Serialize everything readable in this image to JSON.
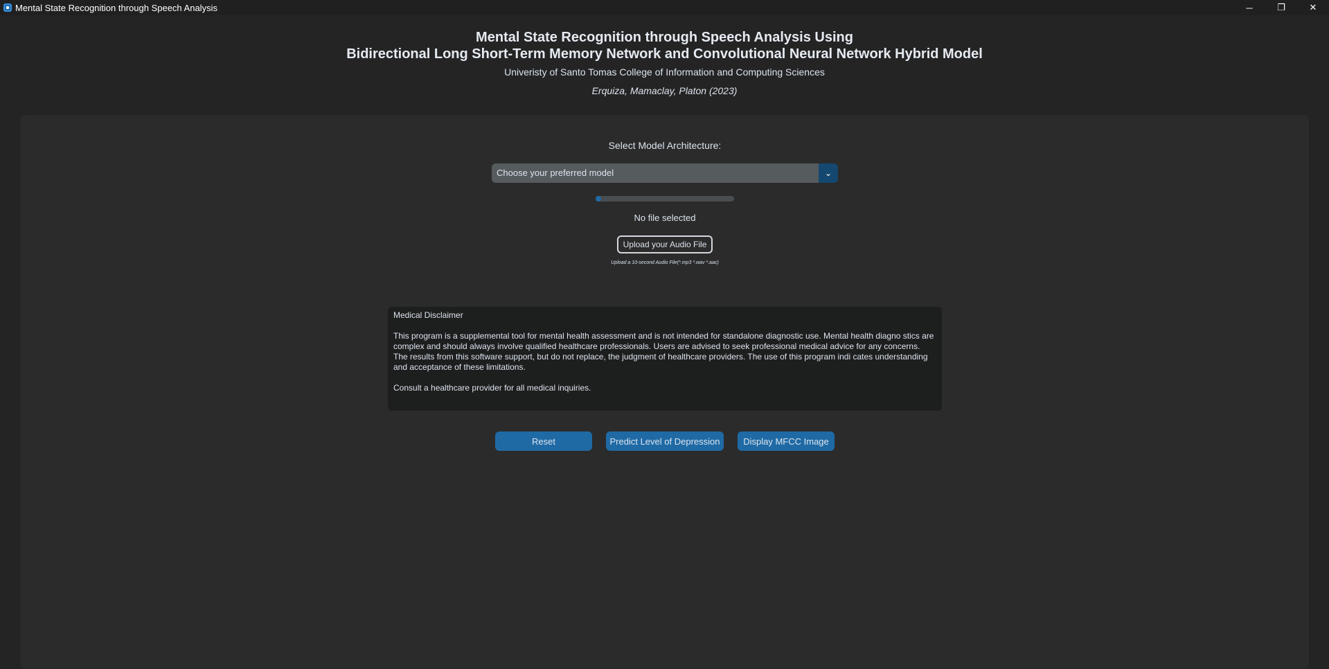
{
  "window": {
    "title": "Mental State Recognition through Speech Analysis",
    "minimize_symbol": "─",
    "restore_symbol": "❐",
    "close_symbol": "✕"
  },
  "header": {
    "title_line1": "Mental State Recognition through Speech Analysis Using",
    "title_line2": "Bidirectional Long Short-Term Memory Network and Convolutional Neural Network Hybrid Model",
    "subtitle": "Univeristy of Santo Tomas College of Information and Computing Sciences",
    "authors": "Erquiza, Mamaclay, Platon (2023)"
  },
  "model_select": {
    "label": "Select Model Architecture:",
    "placeholder": "Choose your preferred model",
    "arrow_symbol": "⌄"
  },
  "upload": {
    "progress_fraction": 0.04,
    "status": "No file selected",
    "button_label": "Upload your Audio File",
    "hint": "Upload a 10-second Audio File(*.mp3 *.wav *.aac)"
  },
  "disclaimer": {
    "heading": "Medical Disclaimer",
    "body": "This program is a supplemental tool for mental health assessment and is not intended for standalone diagnostic use. Mental health diagno stics are complex and should always involve qualified healthcare professionals. Users are advised to seek professional medical advice for any concerns. The results from this software support, but do not replace, the judgment of healthcare providers. The use of this program indi cates understanding and acceptance of these limitations.",
    "footer": "Consult a healthcare provider for all medical inquiries."
  },
  "actions": {
    "reset_label": "Reset",
    "predict_label": "Predict Level of Depression",
    "mfcc_label": "Display MFCC Image"
  },
  "colors": {
    "accent": "#1f6aa5",
    "background": "#242424",
    "frame": "#2b2b2b"
  }
}
